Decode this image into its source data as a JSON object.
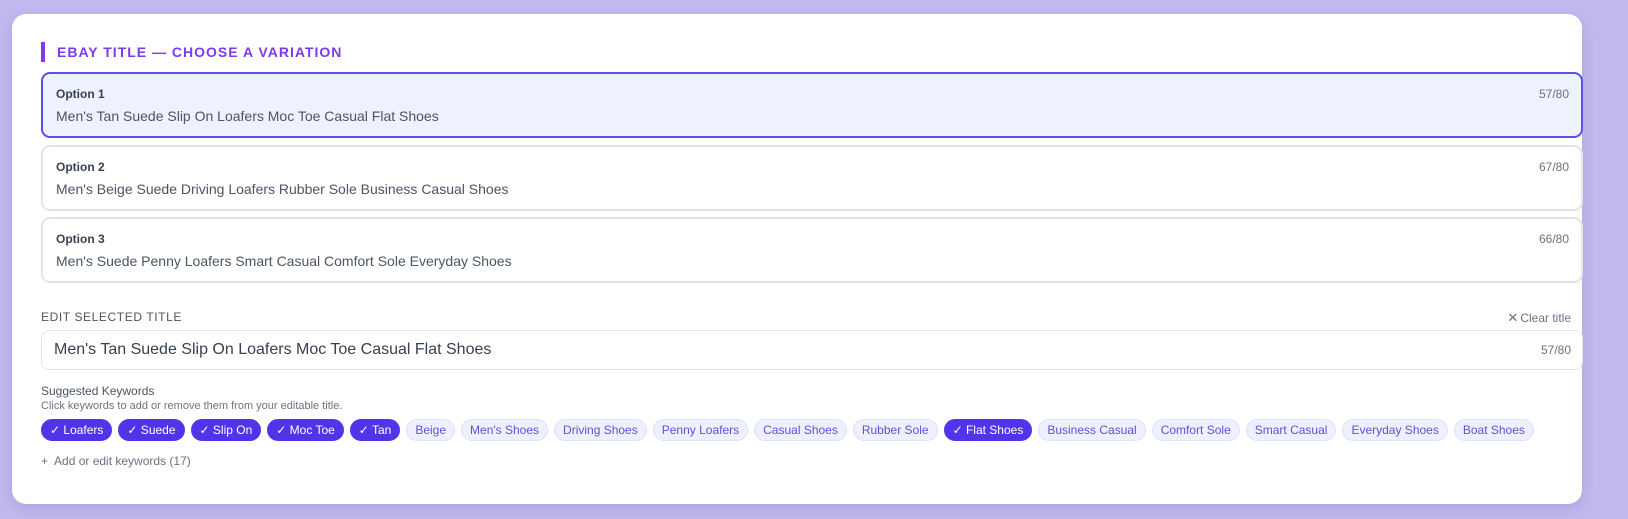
{
  "section_title": "EBAY TITLE — CHOOSE A VARIATION",
  "options": [
    {
      "label": "Option 1",
      "count": "57/80",
      "text": "Men's Tan Suede Slip On Loafers Moc Toe Casual Flat Shoes",
      "selected": true
    },
    {
      "label": "Option 2",
      "count": "67/80",
      "text": "Men's Beige Suede Driving Loafers Rubber Sole Business Casual Shoes",
      "selected": false
    },
    {
      "label": "Option 3",
      "count": "66/80",
      "text": "Men's Suede Penny Loafers Smart Casual Comfort Sole Everyday Shoes",
      "selected": false
    }
  ],
  "edit": {
    "label": "EDIT SELECTED TITLE",
    "clear_label": "Clear title",
    "value": "Men's Tan Suede Slip On Loafers Moc Toe Casual Flat Shoes",
    "count": "57/80"
  },
  "keywords": {
    "heading": "Suggested Keywords",
    "subtext": "Click keywords to add or remove them from your editable title.",
    "items": [
      {
        "label": "✓ Loafers",
        "active": true
      },
      {
        "label": "✓ Suede",
        "active": true
      },
      {
        "label": "✓ Slip On",
        "active": true
      },
      {
        "label": "✓ Moc Toe",
        "active": true
      },
      {
        "label": "✓ Tan",
        "active": true
      },
      {
        "label": "Beige",
        "active": false
      },
      {
        "label": "Men's Shoes",
        "active": false
      },
      {
        "label": "Driving Shoes",
        "active": false
      },
      {
        "label": "Penny Loafers",
        "active": false
      },
      {
        "label": "Casual Shoes",
        "active": false
      },
      {
        "label": "Rubber Sole",
        "active": false
      },
      {
        "label": "✓ Flat Shoes",
        "active": true
      },
      {
        "label": "Business Casual",
        "active": false
      },
      {
        "label": "Comfort Sole",
        "active": false
      },
      {
        "label": "Smart Casual",
        "active": false
      },
      {
        "label": "Everyday Shoes",
        "active": false
      },
      {
        "label": "Boat Shoes",
        "active": false
      }
    ],
    "add_label": "Add or edit keywords (17)"
  },
  "colors": {
    "accent": "#7c3aed",
    "selected_border": "#5b50e8",
    "chip_active": "#5234e8",
    "background": "#c3b8ee"
  },
  "icons": {
    "clear": "close-icon",
    "add": "plus-icon"
  }
}
